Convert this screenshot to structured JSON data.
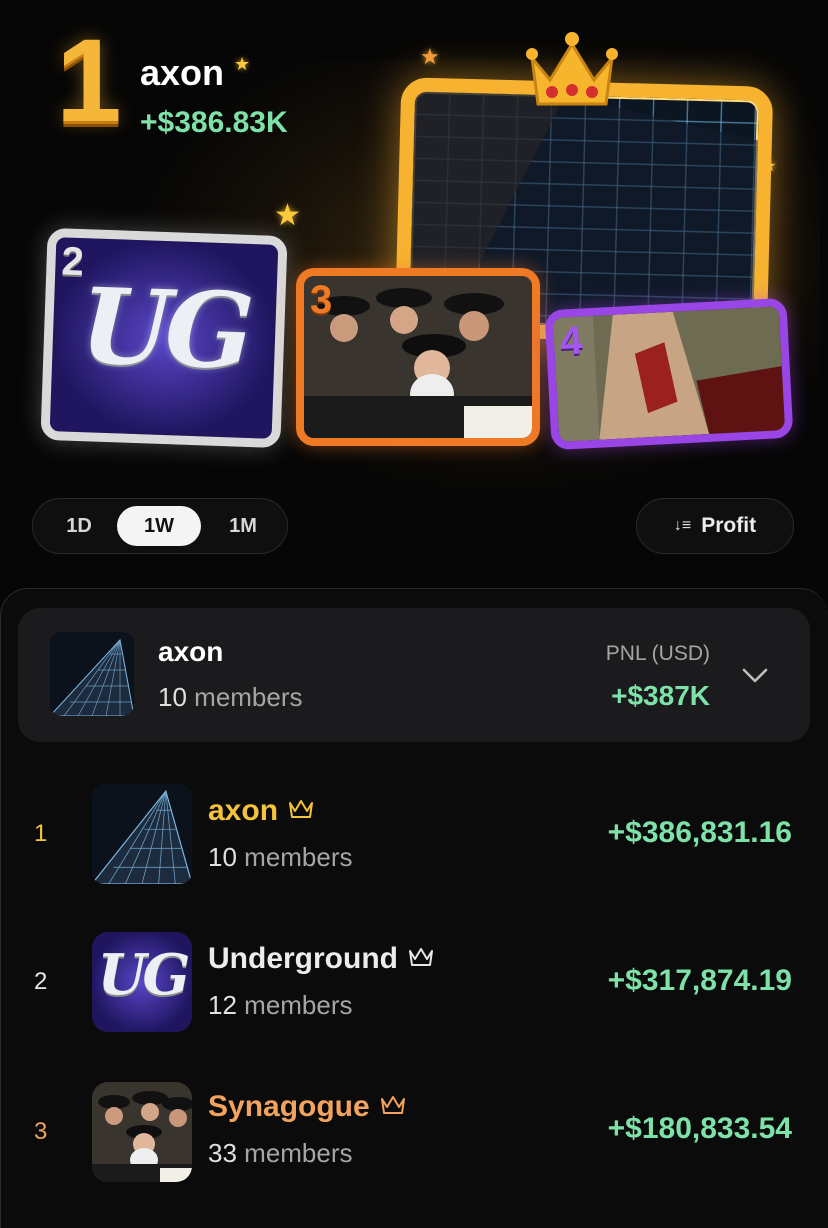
{
  "hero": {
    "rank": "1",
    "name": "axon",
    "pnl": "+$386.83K"
  },
  "podium": [
    {
      "rank": "2",
      "art": "UG"
    },
    {
      "rank": "3"
    },
    {
      "rank": "4"
    }
  ],
  "filters": {
    "periods": [
      "1D",
      "1W",
      "1M"
    ],
    "selected_period": "1W",
    "sort_label": "Profit"
  },
  "my_group": {
    "name": "axon",
    "member_count": "10",
    "members_word": "members",
    "pnl_label": "PNL (USD)",
    "pnl": "+$387K"
  },
  "leaderboard": [
    {
      "rank": "1",
      "name": "axon",
      "member_count": "10",
      "members_word": "members",
      "pnl": "+$386,831.16"
    },
    {
      "rank": "2",
      "name": "Underground",
      "member_count": "12",
      "members_word": "members",
      "pnl": "+$317,874.19"
    },
    {
      "rank": "3",
      "name": "Synagogue",
      "member_count": "33",
      "members_word": "members",
      "pnl": "+$180,833.54"
    }
  ],
  "colors": {
    "gold": "#f4b73a",
    "silver": "#d9d9d9",
    "bronze": "#f07a23",
    "purple": "#9a45e6",
    "profit_green": "#7ee2a8",
    "rank1_name": "#f4c23c",
    "rank3_name": "#f2a35c"
  }
}
